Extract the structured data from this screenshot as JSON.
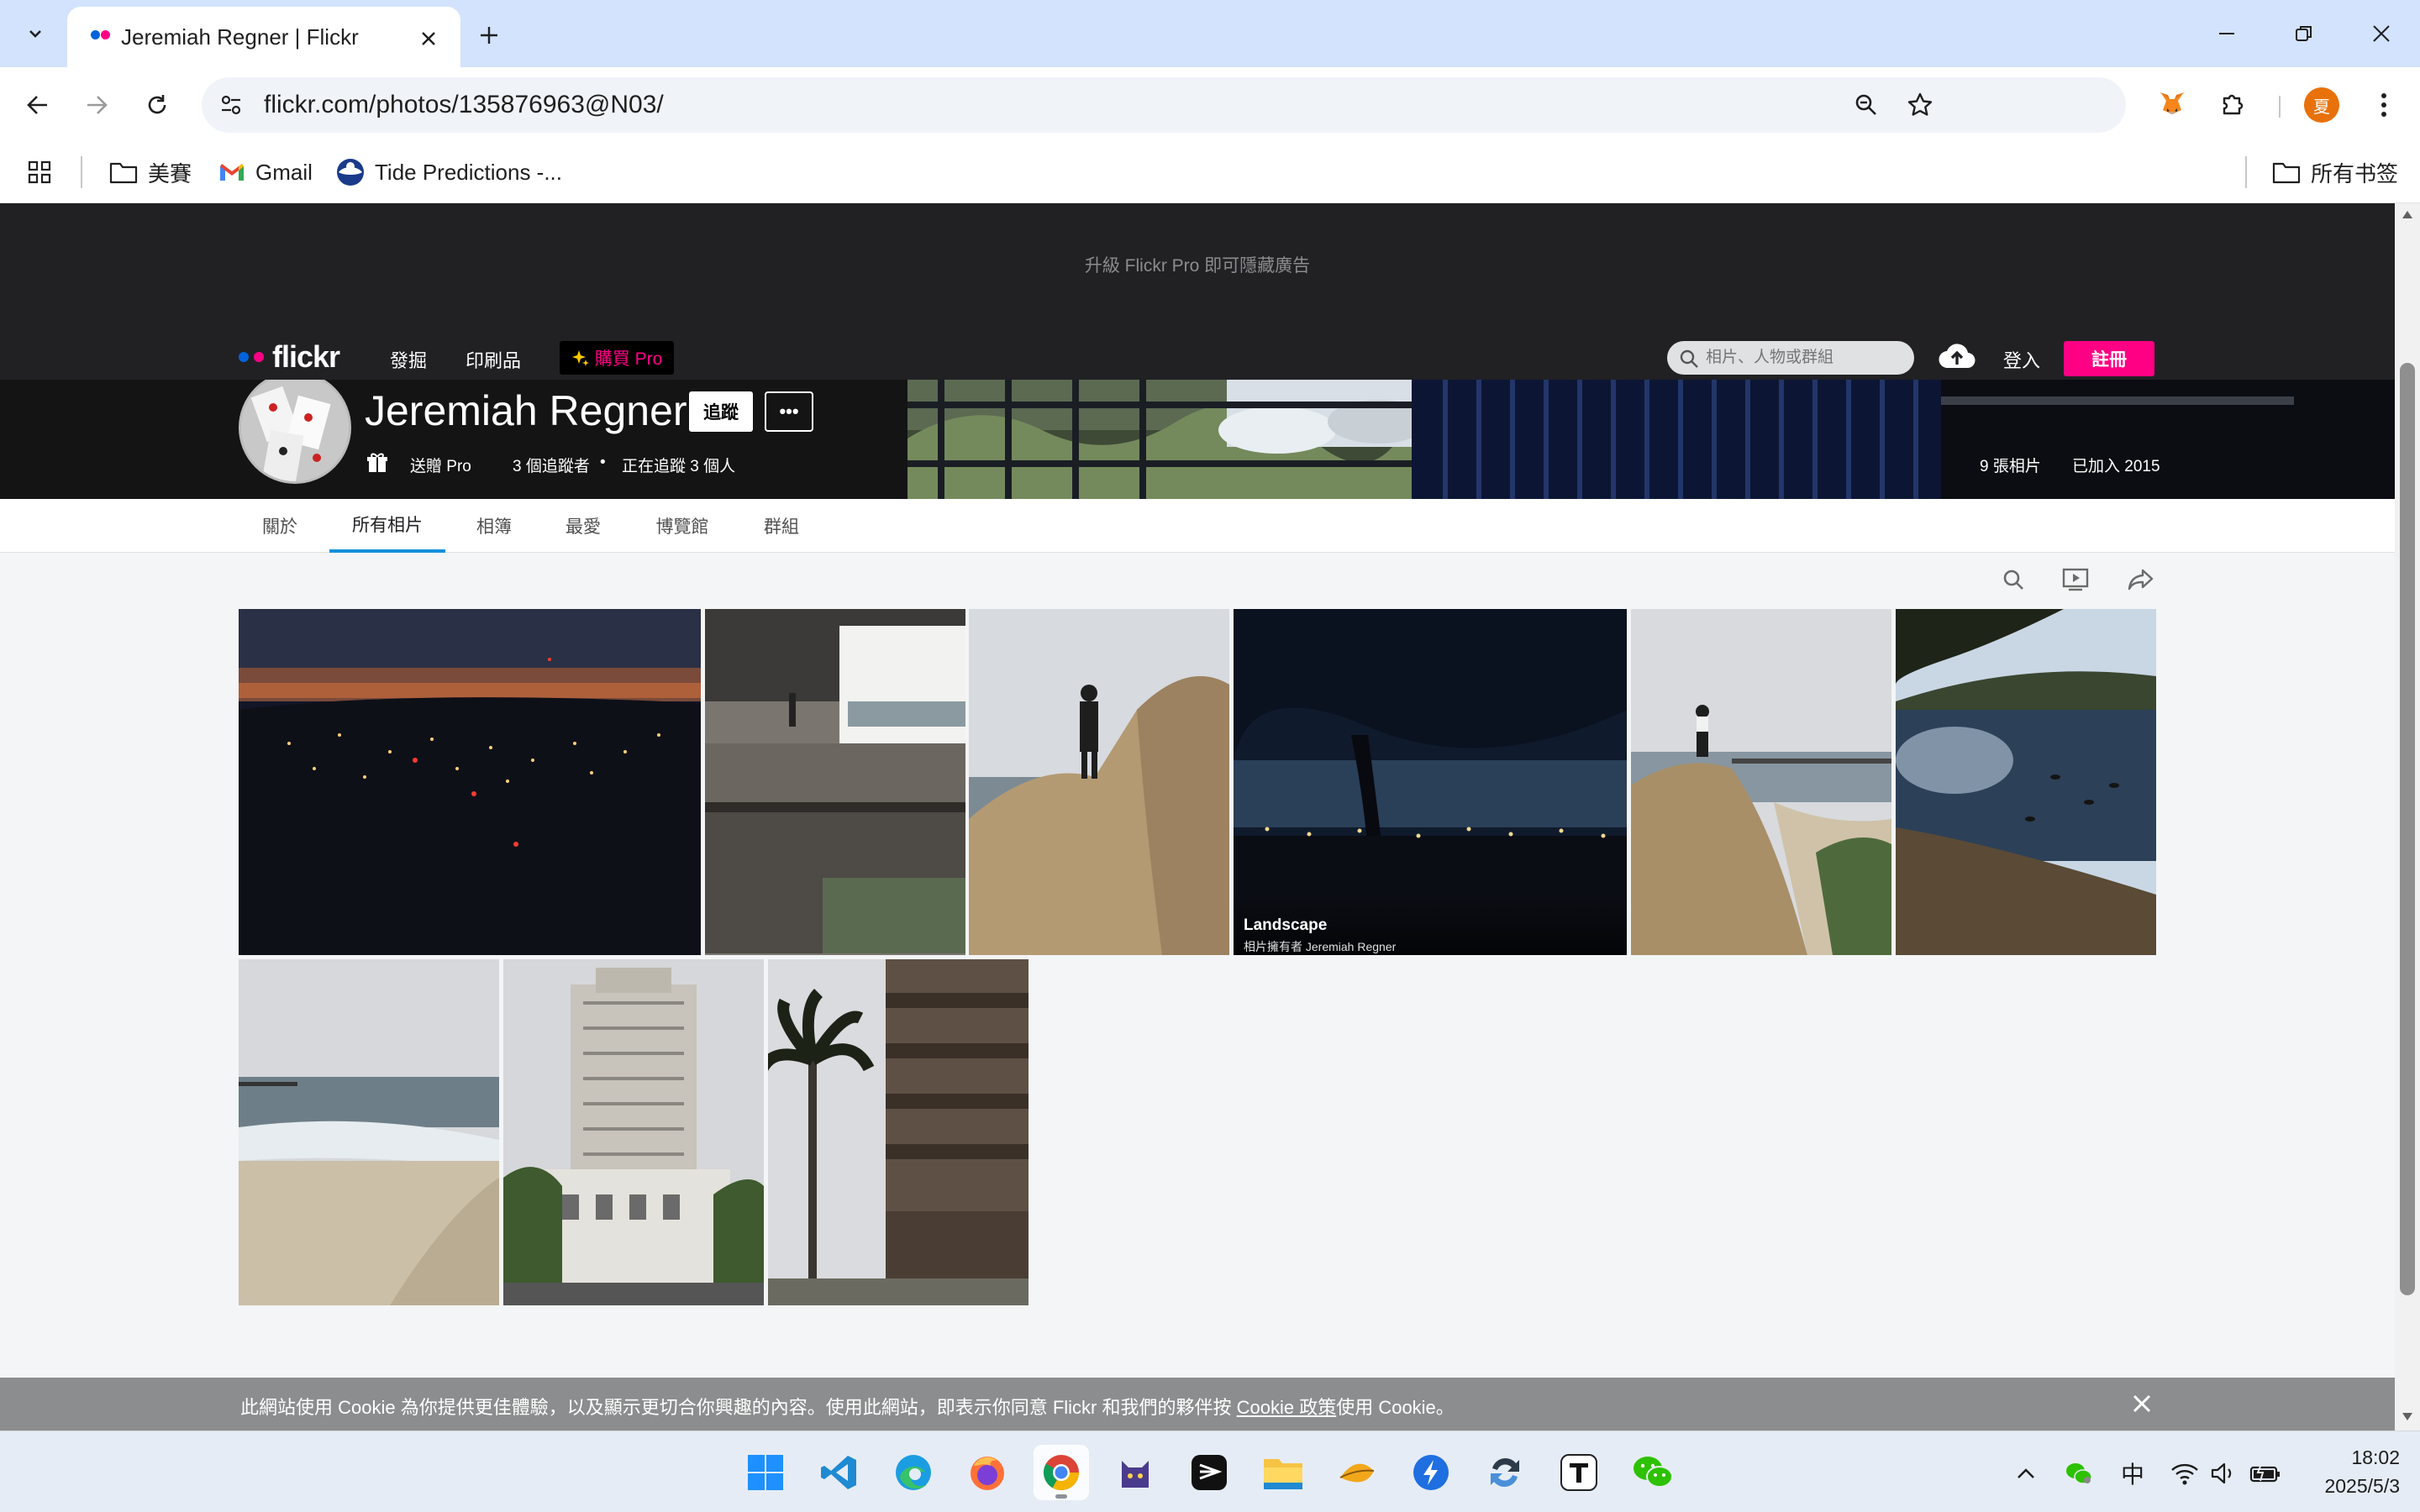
{
  "browser": {
    "tab": {
      "title": "Jeremiah Regner | Flickr",
      "favicon": "flickr-dots-icon"
    },
    "url": "flickr.com/photos/135876963@N03/",
    "profile_initial": "夏",
    "bookmarks": [
      {
        "label": "美賽",
        "icon": "folder-icon"
      },
      {
        "label": "Gmail",
        "icon": "gmail-icon"
      },
      {
        "label": "Tide Predictions -...",
        "icon": "noaa-icon"
      }
    ],
    "all_bookmarks": "所有书签"
  },
  "flickr": {
    "ad_text": "升級 Flickr Pro 即可隱藏廣告",
    "logo_text": "flickr",
    "nav": {
      "explore": "發掘",
      "prints": "印刷品",
      "pro": "購買 Pro"
    },
    "search_placeholder": "相片、人物或群組",
    "login": "登入",
    "signup": "註冊",
    "colors": {
      "pink": "#ff0084",
      "blue": "#0063dc",
      "tab_accent": "#128fdc"
    }
  },
  "profile": {
    "name": "Jeremiah Regner",
    "follow": "追蹤",
    "more": "•••",
    "gift_pro": "送贈 Pro",
    "followers": "3 個追蹤者",
    "following": "正在追蹤 3 個人",
    "photo_count": "9 張相片",
    "joined": "已加入 2015"
  },
  "subnav": [
    "關於",
    "所有相片",
    "相簿",
    "最愛",
    "博覽館",
    "群組"
  ],
  "subnav_active": "所有相片",
  "hovered_photo": {
    "title": "Landscape",
    "owner": "相片擁有者 Jeremiah Regner"
  },
  "cookie": {
    "text_before": "此網站使用 Cookie 為你提供更佳體驗，以及顯示更切合你興趣的內容。使用此網站，即表示你同意 Flickr 和我們的夥伴按 ",
    "link": "Cookie 政策",
    "text_after": "使用 Cookie。"
  },
  "taskbar": {
    "apps": [
      "windows-start-icon",
      "vscode-icon",
      "edge-icon",
      "firefox-icon",
      "chrome-icon",
      "cat-app-icon",
      "capcut-icon",
      "file-explorer-icon",
      "cherry-app-icon",
      "lightning-app-icon",
      "sync-app-icon",
      "typora-icon",
      "wechat-icon"
    ],
    "ime": "中",
    "time": "18:02",
    "date": "2025/5/3"
  }
}
